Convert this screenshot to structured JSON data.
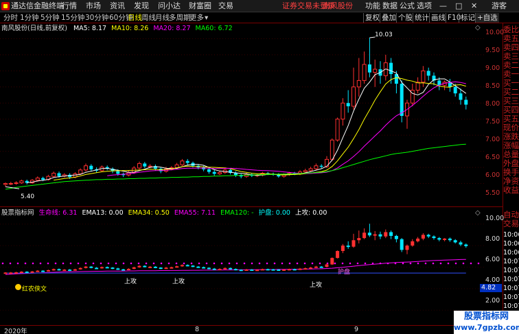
{
  "app": {
    "title": "通达信金融终端",
    "guest": "游客"
  },
  "menu": [
    "行情",
    "市场",
    "资讯",
    "发现",
    "问小达",
    "财富圈",
    "交易"
  ],
  "notice": {
    "warn": "证券交易未登录",
    "stock": "南风股份"
  },
  "win_buttons": [
    "功能",
    "数据",
    "公式",
    "选项"
  ],
  "periods": [
    "分时",
    "1分钟",
    "5分钟",
    "15分钟",
    "30分钟",
    "60分钟",
    "日线",
    "周线",
    "月线",
    "多周期",
    "更多"
  ],
  "active_period": "日线",
  "right_tools": [
    "复权",
    "叠加",
    "个股",
    "统计",
    "画线",
    "F10",
    "标记",
    "+自选"
  ],
  "chart": {
    "stock_label": "南风股份(日线,前复权)",
    "ma": [
      {
        "label": "MA5: 8.17",
        "color": "#ffffff"
      },
      {
        "label": "MA10: 8.26",
        "color": "#ffff00"
      },
      {
        "label": "MA20: 8.27",
        "color": "#ff00ff"
      },
      {
        "label": "MA60: 6.72",
        "color": "#00ff00"
      }
    ],
    "price_ticks": [
      "10.00",
      "9.50",
      "9.00",
      "8.50",
      "8.00",
      "7.50",
      "7.00",
      "6.50",
      "6.00",
      "5.50"
    ],
    "high_label": "10.03",
    "low_label": "5.40",
    "candles": [
      {
        "o": 5.47,
        "c": 5.5,
        "h": 5.53,
        "l": 5.4
      },
      {
        "o": 5.5,
        "c": 5.5,
        "h": 5.55,
        "l": 5.45
      },
      {
        "o": 5.5,
        "c": 5.52,
        "h": 5.57,
        "l": 5.46
      },
      {
        "o": 5.52,
        "c": 5.58,
        "h": 5.62,
        "l": 5.49
      },
      {
        "o": 5.58,
        "c": 5.52,
        "h": 5.62,
        "l": 5.47
      },
      {
        "o": 5.52,
        "c": 5.6,
        "h": 5.64,
        "l": 5.49
      },
      {
        "o": 5.6,
        "c": 5.67,
        "h": 5.72,
        "l": 5.56
      },
      {
        "o": 5.67,
        "c": 5.62,
        "h": 5.71,
        "l": 5.57
      },
      {
        "o": 5.62,
        "c": 5.72,
        "h": 5.77,
        "l": 5.59
      },
      {
        "o": 5.72,
        "c": 5.82,
        "h": 5.87,
        "l": 5.67
      },
      {
        "o": 5.82,
        "c": 5.73,
        "h": 5.87,
        "l": 5.68
      },
      {
        "o": 5.73,
        "c": 5.77,
        "h": 5.82,
        "l": 5.69
      },
      {
        "o": 5.77,
        "c": 5.7,
        "h": 5.82,
        "l": 5.64
      },
      {
        "o": 5.7,
        "c": 5.8,
        "h": 5.85,
        "l": 5.66
      },
      {
        "o": 5.8,
        "c": 5.92,
        "h": 5.97,
        "l": 5.77
      },
      {
        "o": 5.92,
        "c": 6.05,
        "h": 6.12,
        "l": 5.87
      },
      {
        "o": 6.05,
        "c": 5.94,
        "h": 6.1,
        "l": 5.89
      },
      {
        "o": 5.94,
        "c": 5.9,
        "h": 6.0,
        "l": 5.84
      },
      {
        "o": 5.9,
        "c": 6.01,
        "h": 6.06,
        "l": 5.86
      },
      {
        "o": 6.01,
        "c": 5.96,
        "h": 6.06,
        "l": 5.91
      },
      {
        "o": 5.96,
        "c": 5.88,
        "h": 6.0,
        "l": 5.82
      },
      {
        "o": 5.88,
        "c": 5.8,
        "h": 5.94,
        "l": 5.74
      },
      {
        "o": 5.8,
        "c": 5.76,
        "h": 5.84,
        "l": 5.7
      },
      {
        "o": 5.76,
        "c": 5.84,
        "h": 5.9,
        "l": 5.72
      },
      {
        "o": 5.84,
        "c": 5.98,
        "h": 6.04,
        "l": 5.8
      },
      {
        "o": 5.98,
        "c": 6.12,
        "h": 6.18,
        "l": 5.94
      },
      {
        "o": 6.12,
        "c": 6.03,
        "h": 6.17,
        "l": 5.98
      },
      {
        "o": 6.03,
        "c": 6.04,
        "h": 6.1,
        "l": 5.98
      },
      {
        "o": 6.04,
        "c": 5.96,
        "h": 6.09,
        "l": 5.9
      },
      {
        "o": 5.96,
        "c": 5.88,
        "h": 6.0,
        "l": 5.82
      },
      {
        "o": 5.88,
        "c": 5.95,
        "h": 6.02,
        "l": 5.84
      },
      {
        "o": 5.95,
        "c": 5.99,
        "h": 6.04,
        "l": 5.91
      },
      {
        "o": 5.99,
        "c": 6.08,
        "h": 6.14,
        "l": 5.95
      },
      {
        "o": 6.08,
        "c": 6.2,
        "h": 6.26,
        "l": 6.04
      },
      {
        "o": 6.2,
        "c": 6.14,
        "h": 6.26,
        "l": 6.08
      },
      {
        "o": 6.14,
        "c": 6.05,
        "h": 6.18,
        "l": 6.0
      },
      {
        "o": 6.05,
        "c": 6.0,
        "h": 6.1,
        "l": 5.94
      },
      {
        "o": 6.0,
        "c": 5.94,
        "h": 6.05,
        "l": 5.88
      },
      {
        "o": 5.94,
        "c": 5.86,
        "h": 5.98,
        "l": 5.8
      },
      {
        "o": 5.86,
        "c": 5.8,
        "h": 5.92,
        "l": 5.74
      },
      {
        "o": 5.8,
        "c": 5.84,
        "h": 5.9,
        "l": 5.76
      },
      {
        "o": 5.84,
        "c": 5.92,
        "h": 5.97,
        "l": 5.8
      },
      {
        "o": 5.92,
        "c": 5.83,
        "h": 5.96,
        "l": 5.78
      },
      {
        "o": 5.83,
        "c": 5.76,
        "h": 5.88,
        "l": 5.7
      },
      {
        "o": 5.76,
        "c": 5.72,
        "h": 5.8,
        "l": 5.66
      },
      {
        "o": 5.72,
        "c": 5.78,
        "h": 5.83,
        "l": 5.68
      },
      {
        "o": 5.78,
        "c": 5.74,
        "h": 5.82,
        "l": 5.7
      },
      {
        "o": 5.74,
        "c": 5.76,
        "h": 5.8,
        "l": 5.7
      },
      {
        "o": 5.76,
        "c": 5.82,
        "h": 5.86,
        "l": 5.72
      },
      {
        "o": 5.82,
        "c": 5.8,
        "h": 5.86,
        "l": 5.76
      },
      {
        "o": 5.8,
        "c": 5.78,
        "h": 5.84,
        "l": 5.74
      },
      {
        "o": 5.78,
        "c": 5.72,
        "h": 5.82,
        "l": 5.68
      },
      {
        "o": 5.72,
        "c": 5.78,
        "h": 5.82,
        "l": 5.68
      },
      {
        "o": 5.78,
        "c": 5.82,
        "h": 5.86,
        "l": 5.74
      },
      {
        "o": 5.82,
        "c": 5.8,
        "h": 5.86,
        "l": 5.76
      },
      {
        "o": 5.8,
        "c": 5.86,
        "h": 5.92,
        "l": 5.76
      },
      {
        "o": 5.86,
        "c": 5.9,
        "h": 5.96,
        "l": 5.82
      },
      {
        "o": 5.9,
        "c": 5.96,
        "h": 6.02,
        "l": 5.86
      },
      {
        "o": 5.96,
        "c": 6.05,
        "h": 6.12,
        "l": 5.92
      },
      {
        "o": 6.05,
        "c": 6.02,
        "h": 6.1,
        "l": 5.98
      },
      {
        "o": 6.02,
        "c": 6.25,
        "h": 6.35,
        "l": 5.98
      },
      {
        "o": 6.25,
        "c": 6.85,
        "h": 6.9,
        "l": 6.2
      },
      {
        "o": 6.85,
        "c": 7.5,
        "h": 7.55,
        "l": 6.8
      },
      {
        "o": 7.5,
        "c": 8.0,
        "h": 8.15,
        "l": 7.3
      },
      {
        "o": 8.0,
        "c": 7.9,
        "h": 8.4,
        "l": 7.7
      },
      {
        "o": 7.9,
        "c": 8.5,
        "h": 9.1,
        "l": 7.8
      },
      {
        "o": 8.5,
        "c": 8.7,
        "h": 9.4,
        "l": 8.2
      },
      {
        "o": 8.7,
        "c": 9.2,
        "h": 9.6,
        "l": 8.6
      },
      {
        "o": 9.2,
        "c": 8.95,
        "h": 10.03,
        "l": 8.8
      },
      {
        "o": 8.95,
        "c": 9.05,
        "h": 9.35,
        "l": 8.5
      },
      {
        "o": 9.05,
        "c": 8.85,
        "h": 9.3,
        "l": 8.6
      },
      {
        "o": 8.85,
        "c": 9.25,
        "h": 9.5,
        "l": 8.7
      },
      {
        "o": 9.25,
        "c": 8.9,
        "h": 9.4,
        "l": 8.6
      },
      {
        "o": 8.9,
        "c": 8.6,
        "h": 9.0,
        "l": 8.3
      },
      {
        "o": 8.6,
        "c": 7.6,
        "h": 8.7,
        "l": 7.4
      },
      {
        "o": 7.6,
        "c": 8.0,
        "h": 8.1,
        "l": 7.2
      },
      {
        "o": 8.0,
        "c": 8.4,
        "h": 8.6,
        "l": 7.9
      },
      {
        "o": 8.4,
        "c": 8.65,
        "h": 8.8,
        "l": 8.3
      },
      {
        "o": 8.65,
        "c": 9.0,
        "h": 9.15,
        "l": 8.5
      },
      {
        "o": 9.0,
        "c": 8.85,
        "h": 9.1,
        "l": 8.7
      },
      {
        "o": 8.85,
        "c": 8.7,
        "h": 8.95,
        "l": 8.55
      },
      {
        "o": 8.7,
        "c": 8.55,
        "h": 8.8,
        "l": 8.4
      },
      {
        "o": 8.55,
        "c": 8.65,
        "h": 8.7,
        "l": 8.4
      },
      {
        "o": 8.65,
        "c": 8.5,
        "h": 8.75,
        "l": 8.35
      },
      {
        "o": 8.5,
        "c": 8.3,
        "h": 8.6,
        "l": 8.2
      },
      {
        "o": 8.3,
        "c": 8.1,
        "h": 8.45,
        "l": 7.95
      },
      {
        "o": 8.1,
        "c": 7.95,
        "h": 8.2,
        "l": 7.8
      }
    ],
    "ma60": [
      5.32,
      5.35,
      5.38,
      5.4,
      5.42,
      5.44,
      5.46,
      5.48,
      5.5,
      5.52,
      5.54,
      5.56,
      5.57,
      5.58,
      5.59,
      5.6,
      5.61,
      5.62,
      5.62,
      5.63,
      5.63,
      5.64,
      5.64,
      5.65,
      5.65,
      5.66,
      5.66,
      5.67,
      5.67,
      5.68,
      5.68,
      5.69,
      5.69,
      5.7,
      5.7,
      5.71,
      5.71,
      5.72,
      5.72,
      5.73,
      5.73,
      5.74,
      5.74,
      5.75,
      5.75,
      5.76,
      5.76,
      5.77,
      5.77,
      5.78,
      5.78,
      5.79,
      5.79,
      5.8,
      5.8,
      5.81,
      5.82,
      5.83,
      5.84,
      5.85,
      5.87,
      5.9,
      5.94,
      5.99,
      6.04,
      6.09,
      6.14,
      6.19,
      6.24,
      6.28,
      6.32,
      6.36,
      6.4,
      6.43,
      6.45,
      6.47,
      6.5,
      6.53,
      6.56,
      6.59,
      6.61,
      6.63,
      6.65,
      6.67,
      6.69,
      6.71,
      6.72
    ]
  },
  "indicator": {
    "legend": [
      {
        "label": "股票指标网",
        "color": "#dddddd"
      },
      {
        "label": "生命线: 6.31",
        "color": "#ff00ff"
      },
      {
        "label": "EMA13: 0.00",
        "color": "#ffffff"
      },
      {
        "label": "EMA34: 0.50",
        "color": "#ffff00"
      },
      {
        "label": "EMA55: 7.11",
        "color": "#ff00ff"
      },
      {
        "label": "EMA120: -",
        "color": "#00ff00"
      },
      {
        "label": "护盘: 0.00",
        "color": "#00ffff"
      },
      {
        "label": "上攻: 0.00",
        "color": "#ffffff"
      }
    ],
    "ticks": [
      "10.00",
      "8.00",
      "6.00",
      "4.00",
      "2.00"
    ],
    "current_value": "4.82",
    "annotations": [
      "上攻",
      "上攻",
      "上攻",
      "护盘"
    ],
    "bottom_label": "红农侠文"
  },
  "dates": [
    "2020年",
    "8",
    "9"
  ],
  "side_panel": {
    "labels": [
      "委比",
      "卖五",
      "卖四",
      "卖三",
      "卖二",
      "卖一",
      "买一",
      "买二",
      "买三",
      "买四",
      "买五",
      "现价",
      "涨跌",
      "涨幅",
      "总量",
      "外盘",
      "换手",
      "净资",
      "收益"
    ],
    "labels2": [
      "自动",
      "交易"
    ],
    "times": [
      "10:06",
      "10:06",
      "10:06",
      "10:07",
      "10:07",
      "10:07",
      "10:07",
      "10:07",
      "10:07"
    ]
  },
  "watermark": {
    "line1": "股票指标网",
    "line2": "www.7gpzb.com"
  }
}
